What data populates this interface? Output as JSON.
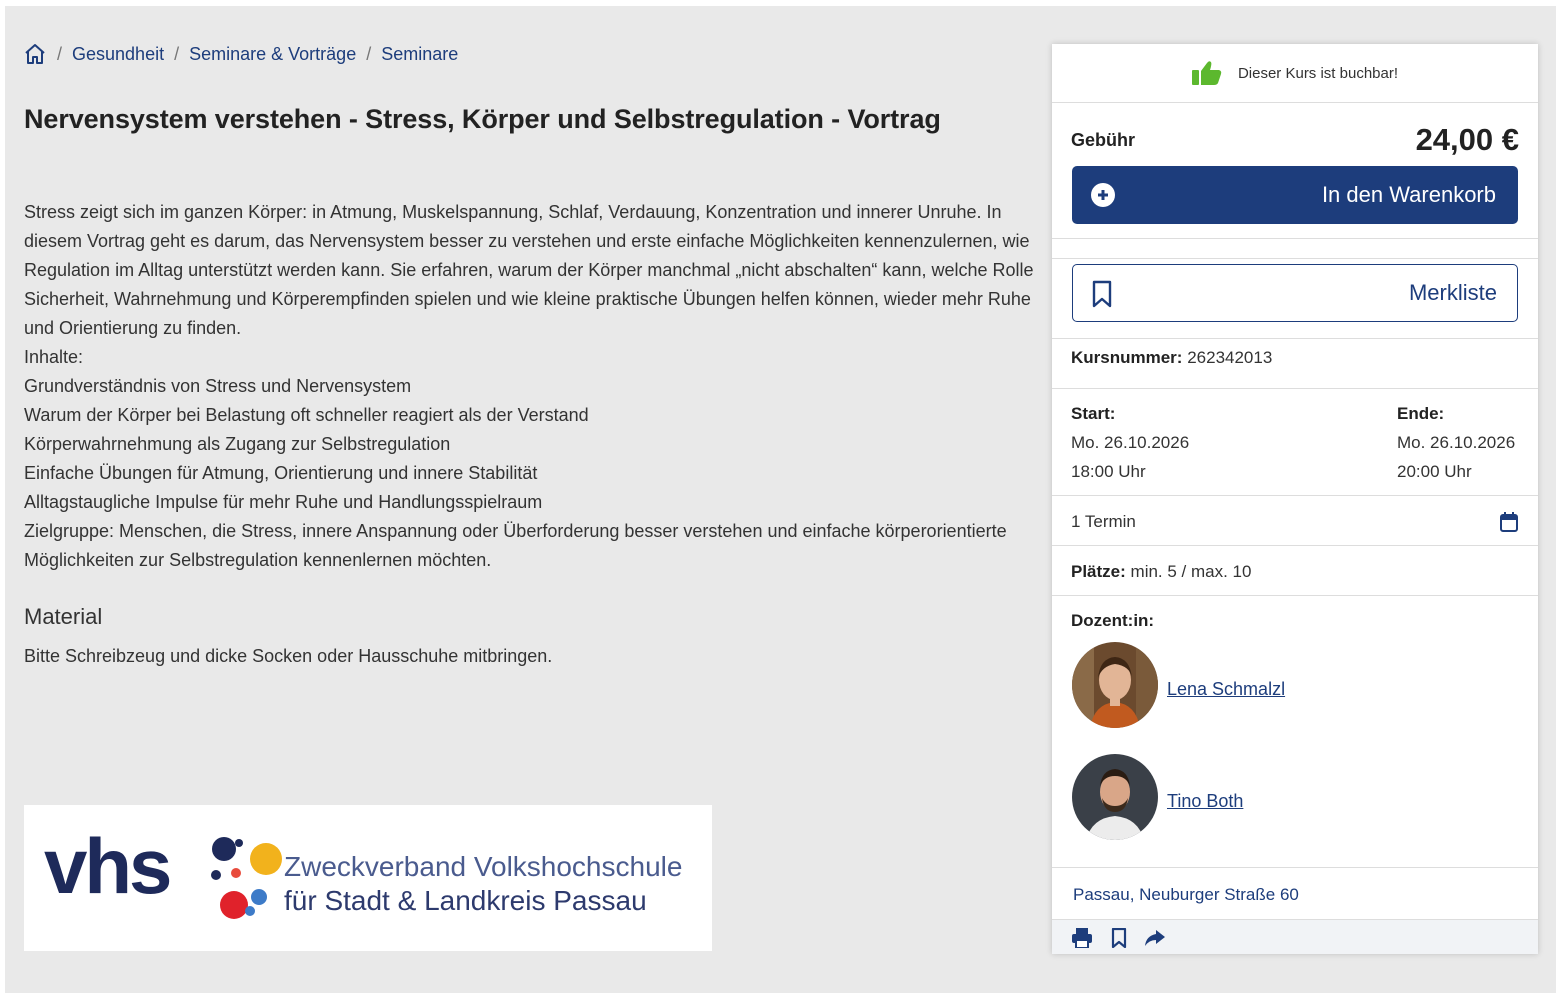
{
  "breadcrumb": {
    "items": [
      "Gesundheit",
      "Seminare & Vorträge",
      "Seminare"
    ],
    "separator": "/"
  },
  "title": "Nervensystem verstehen - Stress, Körper und Selbstregulation - Vortrag",
  "description": {
    "paragraph": "Stress zeigt sich im ganzen Körper: in Atmung, Muskelspannung, Schlaf, Verdauung, Konzentration und innerer Unruhe. In diesem Vortrag geht es darum, das Nervensystem besser zu verstehen und erste einfache Möglichkeiten kennenzulernen, wie Regulation im Alltag unterstützt werden kann. Sie erfahren, warum der Körper manchmal „nicht abschalten“ kann, welche Rolle Sicherheit, Wahrnehmung und Körperempfinden spielen und wie kleine praktische Übungen helfen können, wieder mehr Ruhe und Orientierung zu finden.",
    "contents_heading": "Inhalte:",
    "contents": [
      "Grundverständnis von Stress und Nervensystem",
      "Warum der Körper bei Belastung oft schneller reagiert als der Verstand",
      "Körperwahrnehmung als Zugang zur Selbstregulation",
      "Einfache Übungen für Atmung, Orientierung und innere Stabilität",
      "Alltagstaugliche Impulse für mehr Ruhe und Handlungsspielraum"
    ],
    "target_group": "Zielgruppe: Menschen, die Stress, innere Anspannung oder Überforderung besser verstehen und einfache körperorientierte Möglichkeiten zur Selbstregulation kennenlernen möchten."
  },
  "material": {
    "heading": "Material",
    "text": "Bitte Schreibzeug und dicke Socken oder Hausschuhe mitbringen."
  },
  "logo": {
    "wordmark": "vhs",
    "line1": "Zweckverband Volkshochschule",
    "line2": "für Stadt & Landkreis Passau"
  },
  "card": {
    "bookable": "Dieser Kurs ist buchbar!",
    "fee_label": "Gebühr",
    "fee_value": "24,00 €",
    "cart_button": "In den Warenkorb",
    "memo_button": "Merkliste",
    "course_number_label": "Kursnummer:",
    "course_number": "262342013",
    "start_label": "Start:",
    "start_date": "Mo. 26.10.2026",
    "start_time": "18:00 Uhr",
    "end_label": "Ende:",
    "end_date": "Mo. 26.10.2026",
    "end_time": "20:00 Uhr",
    "appointments": "1 Termin",
    "places_label": "Plätze:",
    "places_value": "min. 5 / max. 10",
    "lecturer_label": "Dozent:in:",
    "lecturers": [
      "Lena Schmalzl",
      "Tino Both"
    ],
    "location": "Passau, Neuburger Straße 60"
  },
  "colors": {
    "primary": "#1d3d7c",
    "thumb": "#5cb82e",
    "page_bg": "#e9e9e9"
  },
  "icons": [
    "home-icon",
    "thumbs-up-icon",
    "plus-circle-icon",
    "bookmark-icon",
    "calendar-icon",
    "print-icon",
    "share-icon"
  ]
}
